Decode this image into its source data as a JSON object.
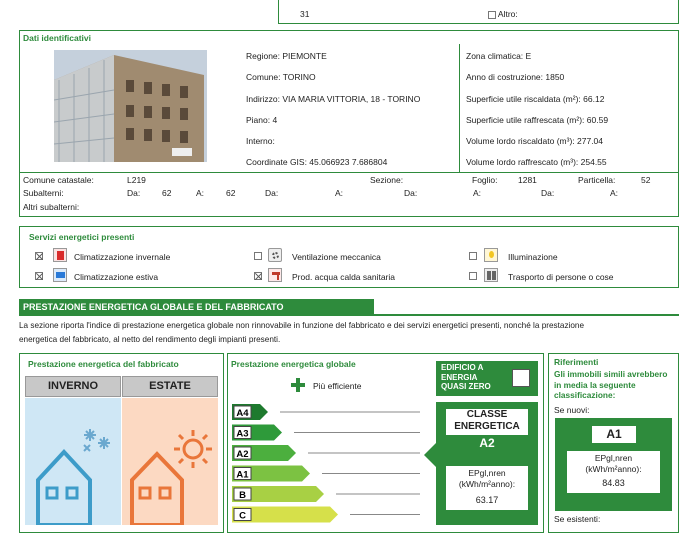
{
  "top": {
    "value": "31",
    "other_label": "Altro:"
  },
  "ident": {
    "title": "Dati identificativi",
    "regione": "Regione: PIEMONTE",
    "comune": "Comune: TORINO",
    "indirizzo": "Indirizzo: VIA MARIA VITTORIA, 18 - TORINO",
    "piano": "Piano: 4",
    "interno": "Interno:",
    "coordinate": "Coordinate GIS: 45.066923 7.686804",
    "zona": "Zona climatica: E",
    "anno": "Anno di costruzione: 1850",
    "sup_risc": "Superficie utile riscaldata (m²): 66.12",
    "sup_raff": "Superficie utile raffrescata (m²): 60.59",
    "vol_risc": "Volume lordo riscaldato (m³): 277.04",
    "vol_raff": "Volume lordo raffrescato (m³): 254.55"
  },
  "catasto": {
    "comune_label": "Comune catastale:",
    "comune_value": "L219",
    "sezione_label": "Sezione:",
    "foglio_label": "Foglio:",
    "foglio_value": "1281",
    "particella_label": "Particella:",
    "particella_value": "52",
    "subalterni_label": "Subalterni:",
    "da": "Da:",
    "a": "A:",
    "sub1_da": "62",
    "sub1_a": "62",
    "altri_label": "Altri subalterni:"
  },
  "servizi": {
    "title": "Servizi energetici presenti",
    "items": [
      {
        "label": "Climatizzazione invernale",
        "checked": true
      },
      {
        "label": "Ventilazione meccanica",
        "checked": false
      },
      {
        "label": "Illuminazione",
        "checked": false
      },
      {
        "label": "Climatizzazione estiva",
        "checked": true
      },
      {
        "label": "Prod. acqua calda sanitaria",
        "checked": true
      },
      {
        "label": "Trasporto di persone o cose",
        "checked": false
      }
    ]
  },
  "prestazione": {
    "title": "PRESTAZIONE ENERGETICA GLOBALE E DEL FABBRICATO",
    "desc1": "La sezione riporta l'indice di prestazione energetica globale non rinnovabile in funzione del fabbricato e dei servizi energetici presenti, nonché la prestazione",
    "desc2": "energetica del fabbricato, al netto del rendimento degli impianti presenti."
  },
  "fabbricato": {
    "title": "Prestazione energetica del fabbricato",
    "inverno": "INVERNO",
    "estate": "ESTATE"
  },
  "globale": {
    "title": "Prestazione energetica globale",
    "piu_efficiente": "Più efficiente",
    "classes": [
      "A4",
      "A3",
      "A2",
      "A1",
      "B",
      "C"
    ],
    "class_colors": [
      "#1e7a2e",
      "#2e9a3a",
      "#4caf3e",
      "#7cc242",
      "#a8d044",
      "#d6e04a"
    ],
    "nzeb": "EDIFICIO A ENERGIA QUASI ZERO",
    "classe_label": "CLASSE ENERGETICA",
    "classe_value": "A2",
    "ep_label": "EPgl,nren (kWh/m²anno):",
    "ep_value": "63.17"
  },
  "riferimenti": {
    "title": "Riferimenti",
    "desc": "Gli immobili simili avrebbero in media la seguente classificazione:",
    "nuovi": "Se nuovi:",
    "classe": "A1",
    "ep_label": "EPgl,nren (kWh/m²anno):",
    "ep_value": "84.83",
    "esistenti": "Se esistenti:"
  }
}
